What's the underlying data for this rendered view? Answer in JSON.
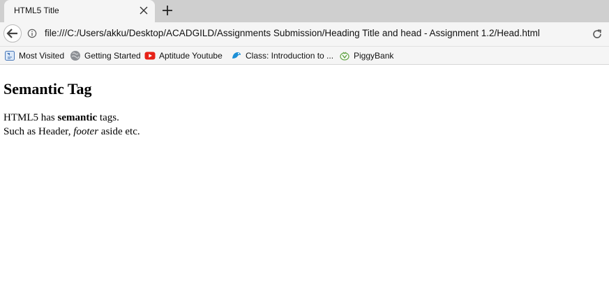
{
  "browser": {
    "tab": {
      "title": "HTML5 Title"
    },
    "address": {
      "url": "file:///C:/Users/akku/Desktop/ACADGILD/Assignments Submission/Heading Title and head - Assignment 1.2/Head.html"
    },
    "bookmarks": [
      {
        "label": "Most Visited",
        "icon": "most-visited-icon"
      },
      {
        "label": "Getting Started",
        "icon": "globe-icon"
      },
      {
        "label": "Aptitude Youtube",
        "icon": "youtube-icon"
      },
      {
        "label": "Class: Introduction to ...",
        "icon": "class-icon"
      },
      {
        "label": "PiggyBank",
        "icon": "piggybank-icon"
      }
    ]
  },
  "page": {
    "heading": "Semantic Tag",
    "line1": {
      "prefix": "HTML5 has ",
      "bold": "semantic",
      "suffix": " tags."
    },
    "line2": {
      "prefix": "Such as Header, ",
      "italic": "footer",
      "suffix": " aside etc."
    }
  },
  "colors": {
    "tab_active": "#f5f5f5",
    "tab_strip": "#cfcfcf",
    "toolbar": "#f5f5f5",
    "youtube_red": "#e62117"
  }
}
